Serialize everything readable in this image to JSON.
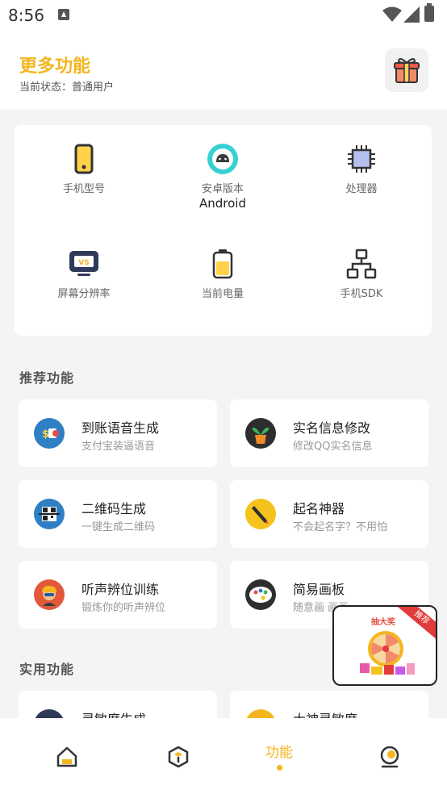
{
  "status_bar": {
    "time": "8:56"
  },
  "header": {
    "title": "更多功能",
    "status": "当前状态：普通用户"
  },
  "device_info": [
    {
      "label": "手机型号",
      "value": ""
    },
    {
      "label": "安卓版本",
      "value": "Android"
    },
    {
      "label": "处理器",
      "value": ""
    },
    {
      "label": "屏幕分辨率",
      "value": ""
    },
    {
      "label": "当前电量",
      "value": ""
    },
    {
      "label": "手机SDK",
      "value": ""
    }
  ],
  "sections": {
    "recommended": "推荐功能",
    "practical": "实用功能"
  },
  "recommended": [
    {
      "title": "到账语音生成",
      "subtitle": "支付宝装逼语音"
    },
    {
      "title": "实名信息修改",
      "subtitle": "修改QQ实名信息"
    },
    {
      "title": "二维码生成",
      "subtitle": "一键生成二维码"
    },
    {
      "title": "起名神器",
      "subtitle": "不会起名字？不用怕"
    },
    {
      "title": "听声辨位训练",
      "subtitle": "锻炼你的听声辨位"
    },
    {
      "title": "简易画板",
      "subtitle": "随意画 画画"
    }
  ],
  "practical": [
    {
      "title": "灵敏度生成"
    },
    {
      "title": "大神灵敏度"
    }
  ],
  "lottery": {
    "title": "抽大奖",
    "badge": "推荐"
  },
  "bottom_nav": {
    "active_label": "功能"
  },
  "colors": {
    "accent": "#f5b51e",
    "background": "#f4f4f4"
  }
}
